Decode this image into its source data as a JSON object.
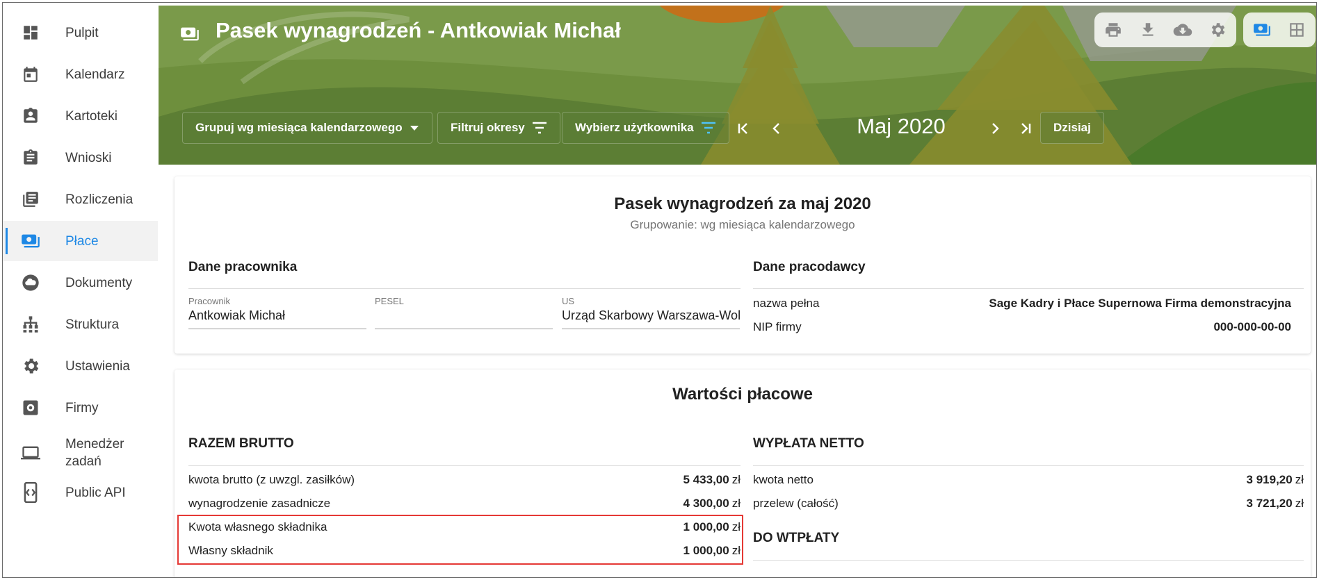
{
  "sidebar": {
    "items": [
      {
        "label": "Pulpit",
        "icon": "dashboard-icon"
      },
      {
        "label": "Kalendarz",
        "icon": "calendar-icon"
      },
      {
        "label": "Kartoteki",
        "icon": "contact-card-icon"
      },
      {
        "label": "Wnioski",
        "icon": "clipboard-icon"
      },
      {
        "label": "Rozliczenia",
        "icon": "document-list-icon"
      },
      {
        "label": "Płace",
        "icon": "payments-icon",
        "active": true
      },
      {
        "label": "Dokumenty",
        "icon": "cloud-icon"
      },
      {
        "label": "Struktura",
        "icon": "org-structure-icon"
      },
      {
        "label": "Ustawienia",
        "icon": "gear-icon"
      },
      {
        "label": "Firmy",
        "icon": "company-settings-icon"
      },
      {
        "label": "Menedżer zadań",
        "icon": "laptop-icon"
      },
      {
        "label": "Public API",
        "icon": "api-icon"
      }
    ]
  },
  "header": {
    "title": "Pasek wynagrodzeń - Antkowiak Michał",
    "group_by": "Grupuj wg miesiąca kalendarzowego",
    "filter_periods": "Filtruj okresy",
    "select_user": "Wybierz użytkownika",
    "period": "Maj 2020",
    "today": "Dzisiaj"
  },
  "payslip": {
    "title": "Pasek wynagrodzeń za maj 2020",
    "subtitle": "Grupowanie: wg miesiąca kalendarzowego",
    "employee": {
      "heading": "Dane pracownika",
      "fields": [
        {
          "label": "Pracownik",
          "value": "Antkowiak Michał"
        },
        {
          "label": "PESEL",
          "value": ""
        },
        {
          "label": "US",
          "value": "Urząd Skarbowy Warszawa-Wola"
        }
      ]
    },
    "employer": {
      "heading": "Dane pracodawcy",
      "rows": [
        {
          "key": "nazwa pełna",
          "value": "Sage Kadry i Płace Supernowa Firma demonstracyjna"
        },
        {
          "key": "NIP firmy",
          "value": "000-000-00-00"
        }
      ]
    }
  },
  "values": {
    "title": "Wartości płacowe",
    "currency": "zł",
    "gross": {
      "heading": "RAZEM BRUTTO",
      "rows": [
        {
          "key": "kwota brutto (z uwzgl. zasiłków)",
          "value": "5 433,00"
        },
        {
          "key": "wynagrodzenie zasadnicze",
          "value": "4 300,00"
        },
        {
          "key": "Kwota własnego składnika",
          "value": "1 000,00"
        },
        {
          "key": "Własny składnik",
          "value": "1 000,00"
        }
      ]
    },
    "net": {
      "heading": "WYPŁATA NETTO",
      "rows": [
        {
          "key": "kwota netto",
          "value": "3 919,20"
        },
        {
          "key": "przelew (całość)",
          "value": "3 721,20"
        }
      ],
      "to_pay_heading": "DO WTPŁATY"
    }
  },
  "colors": {
    "accent": "#1e88e5",
    "header_green": "#6b8f3a",
    "highlight_red": "#e53935"
  }
}
